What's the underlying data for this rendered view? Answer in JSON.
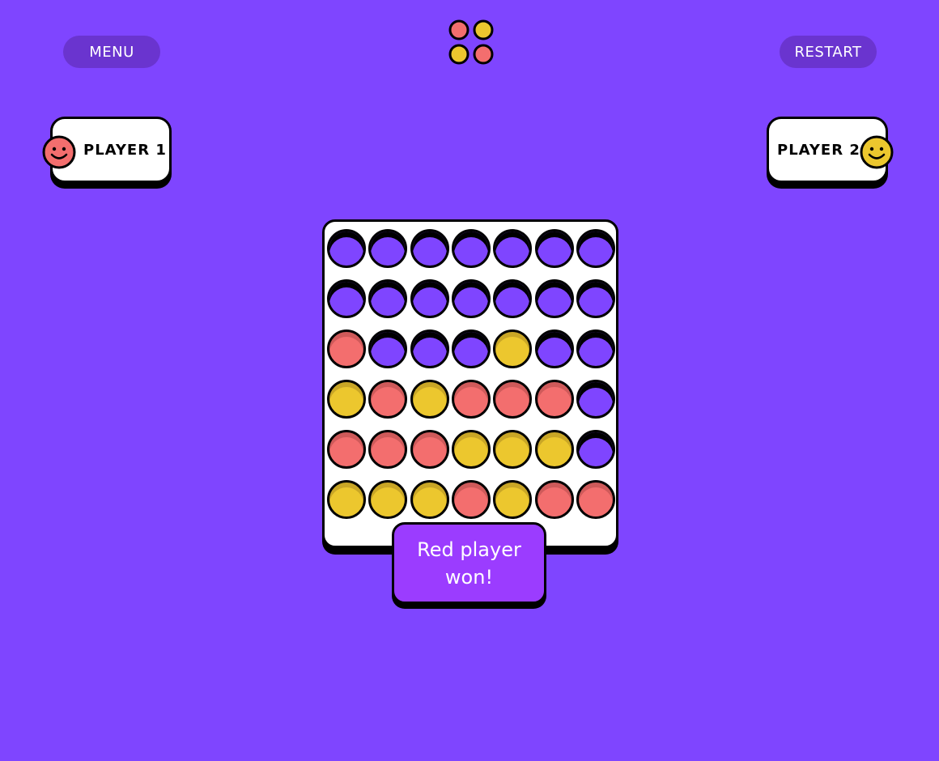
{
  "header": {
    "menu_label": "MENU",
    "restart_label": "RESTART",
    "logo_icon": "four-discs-logo-icon"
  },
  "players": [
    {
      "name": "PLAYER 1",
      "color": "red",
      "avatar_icon": "smiley-face-icon"
    },
    {
      "name": "PLAYER 2",
      "color": "yellow",
      "avatar_icon": "smiley-face-icon"
    }
  ],
  "colors": {
    "background": "#7f45ff",
    "red": "#f36e6e",
    "yellow": "#ecc72e",
    "banner": "#9b3cff",
    "pill": "#6a34cf"
  },
  "board": {
    "rows": 6,
    "columns": 7,
    "cells": [
      [
        "empty",
        "empty",
        "empty",
        "empty",
        "empty",
        "empty",
        "empty"
      ],
      [
        "empty",
        "empty",
        "empty",
        "empty",
        "empty",
        "empty",
        "empty"
      ],
      [
        "red",
        "empty",
        "empty",
        "empty",
        "yellow",
        "empty",
        "empty"
      ],
      [
        "yellow",
        "red",
        "yellow",
        "red",
        "red",
        "red",
        "empty"
      ],
      [
        "red",
        "red",
        "red",
        "yellow",
        "yellow",
        "yellow",
        "empty"
      ],
      [
        "yellow",
        "yellow",
        "yellow",
        "red",
        "yellow",
        "red",
        "red"
      ]
    ]
  },
  "result": {
    "message": "Red player won!"
  }
}
